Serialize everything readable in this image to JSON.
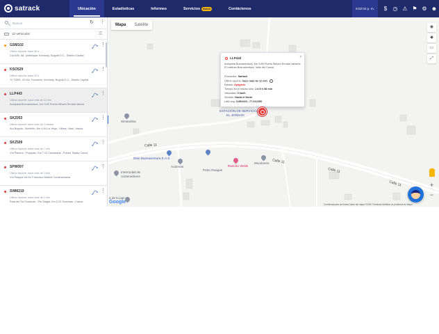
{
  "app": {
    "brand": "satrack",
    "nav": [
      {
        "label": "Ubicación"
      },
      {
        "label": "Estadísticas"
      },
      {
        "label": "Informes"
      },
      {
        "label": "Servicios",
        "badge": "Nuevo"
      },
      {
        "label": "Contáctenos"
      }
    ],
    "time": "6:02:04 p. m.",
    "accent": "#1f2a6b",
    "icons": [
      "dollar-icon",
      "alert-clock-icon",
      "warning-icon",
      "bell-icon",
      "settings-icon",
      "user-icon"
    ]
  },
  "sidebar": {
    "search_placeholder": "Buscar",
    "vehicle_count": "12 vehículos",
    "items": [
      {
        "plate": "GSM102",
        "status": "Último reporte: hace 30 s",
        "address": "Cra 60B, 88, Valledupar, Kennedy, Bogotá D.C., Distrito Capital",
        "dot": "orange"
      },
      {
        "plate": "KSO529",
        "status": "Último reporte: hace 30 s",
        "address": "Tv 72BIS, 43 Sur, Fundamo, Kennedy, Bogotá D.C., Distrito Capital",
        "dot": "red"
      },
      {
        "plate": "LLP443",
        "status": "Último reporte: hace más de 12 min",
        "address": "Autopista Buenaventura, Km 9.89 Puerto Bihuch Ermida Vascla",
        "dot": "red"
      },
      {
        "plate": "SKZ053",
        "status": "Último reporte: hace más de 3 meses",
        "address": "Aut Bogotá - Medellín, Km 4.84 La Vega - Villeta, Vianí, Vascla",
        "dot": "red"
      },
      {
        "plate": "SKZ509",
        "status": "Último reporte: hace más de 7 min",
        "address": "Vía Palmira - Popayán, Km 7.22 Candelaria - Puerto Tejada Cauca",
        "dot": "red"
      },
      {
        "plate": "SPW097",
        "status": "Último reporte: hace más de 3 min",
        "address": "Vía Pasque vid En Francisco Madrid Cundinamarca",
        "dot": "red"
      },
      {
        "plate": "SWM219",
        "status": "Último reporte: hace más de 1 min",
        "address": "Ruta del Sol Guaduas - Pto Salgar, Km 0.22 Guaduas - Cauca",
        "dot": "red"
      }
    ]
  },
  "map": {
    "tabs": [
      {
        "label": "Mapa"
      },
      {
        "label": "Satélite"
      }
    ],
    "popup": {
      "plate": "LLP443",
      "address": "Autopista Buenaventura, Km 9.89 Puerto Bihuch Ermida Variante El Instituto Buenaventura, Valle del Cauca",
      "provider_label": "Proveedor:",
      "provider": "Satrack",
      "last_report_label": "Último reporte:",
      "last_report": "hace más de 12 min",
      "state_label": "Estado:",
      "state": "Apagado",
      "same_place_label": "Tiempo en el mismo sitio:",
      "same_place": "1 d 5 h 58 min",
      "speed_label": "Velocidad:",
      "speed": "0 km/h",
      "direction_label": "Sentido:",
      "direction": "Hacia el Norte",
      "latlng_label": "Lat/Long:",
      "latlng": "3.892420, -77.012250"
    },
    "labels": {
      "poi_top": "EL JORDAN",
      "poi_top2": "ESTACIÓN DE SERVICIO",
      "simandina": "Simandina",
      "street1": "Calle 11",
      "street2": "Calle 11",
      "street3": "Calle 11",
      "street4": "Calle 11",
      "dian": "Dian Buenaventura E.A.S",
      "automas": "Automas",
      "ranchoverde": "Rancho Verde",
      "mundoven": "Mundoven",
      "petro": "Petro Reagan",
      "intermodal1": "Intermodal de",
      "intermodal2": "contenedores",
      "adela": "a de la paz",
      "google": "Google",
      "footer": "Combinaciones de teclas    Datos del mapa ©2024    Términos    Notificar un problema de Maps"
    }
  }
}
